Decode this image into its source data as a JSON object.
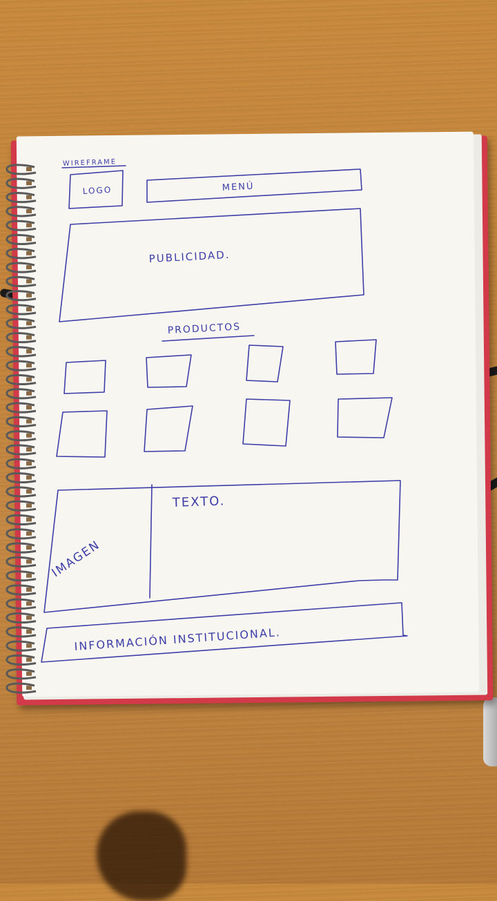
{
  "wireframe": {
    "heading": "WIREFRAME",
    "logo_label": "LOGO",
    "menu_label": "MENÚ",
    "banner_label": "PUBLICIDAD.",
    "products_heading": "PRODUCTOS",
    "products": {
      "columns": 4,
      "rows": 2
    },
    "image_label": "IMAGEN",
    "text_label": "TEXTO.",
    "footer_label": "INFORMACIÓN INSTITUCIONAL."
  },
  "colors": {
    "ink": "#3d3ea8",
    "paper": "#f7f6f1",
    "desk": "#c58842",
    "notebook_cover": "#d23a4a"
  }
}
